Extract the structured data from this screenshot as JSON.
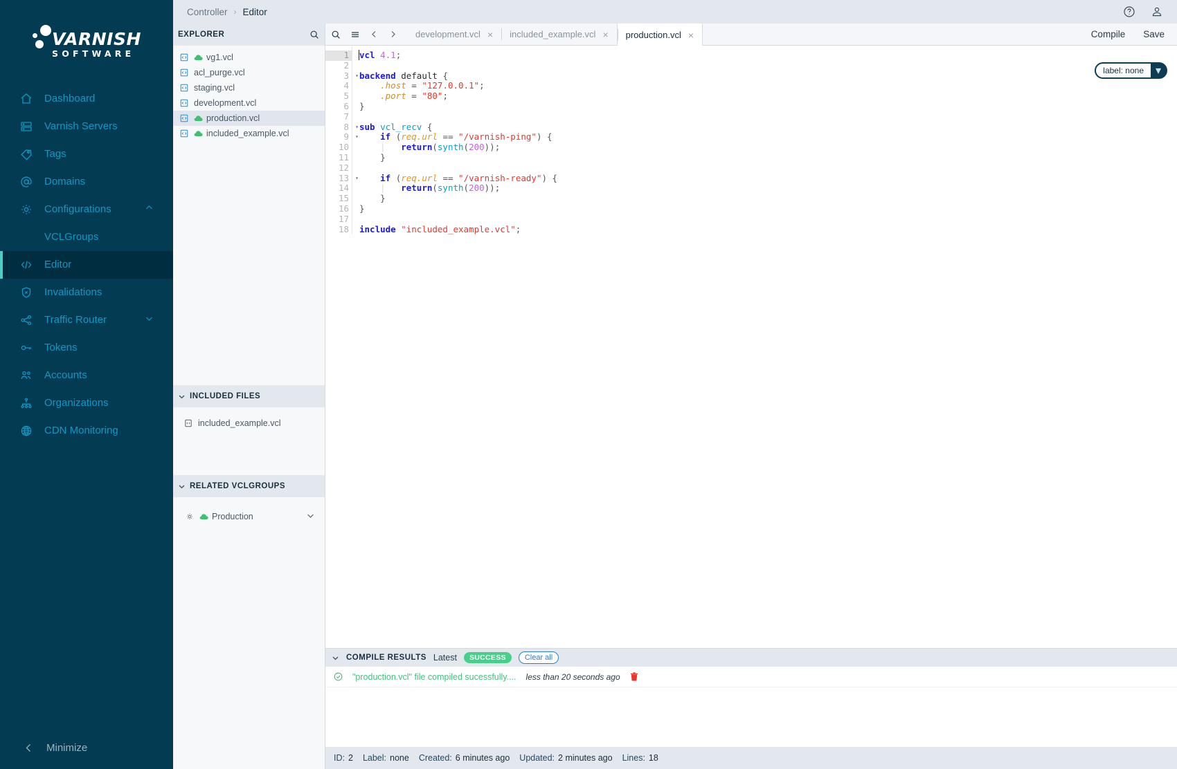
{
  "sidebar": {
    "logo": {
      "top": "VARNISH",
      "bottom": "SOFTWARE"
    },
    "items": [
      {
        "label": "Dashboard",
        "icon": "home-icon",
        "active": false,
        "chevron": ""
      },
      {
        "label": "Varnish Servers",
        "icon": "server-icon",
        "active": false,
        "chevron": ""
      },
      {
        "label": "Tags",
        "icon": "tag-icon",
        "active": false,
        "chevron": ""
      },
      {
        "label": "Domains",
        "icon": "at-icon",
        "active": false,
        "chevron": ""
      },
      {
        "label": "Configurations",
        "icon": "gear-icon",
        "active": false,
        "chevron": "chevron-up-icon"
      },
      {
        "label": "VCLGroups",
        "icon": "",
        "active": false,
        "chevron": "",
        "sub": true
      },
      {
        "label": "Editor",
        "icon": "code-icon",
        "active": true,
        "chevron": ""
      },
      {
        "label": "Invalidations",
        "icon": "shield-x-icon",
        "active": false,
        "chevron": ""
      },
      {
        "label": "Traffic Router",
        "icon": "share-icon",
        "active": false,
        "chevron": "chevron-down-icon"
      },
      {
        "label": "Tokens",
        "icon": "key-icon",
        "active": false,
        "chevron": ""
      },
      {
        "label": "Accounts",
        "icon": "users-icon",
        "active": false,
        "chevron": ""
      },
      {
        "label": "Organizations",
        "icon": "sitemap-icon",
        "active": false,
        "chevron": ""
      },
      {
        "label": "CDN Monitoring",
        "icon": "globe-icon",
        "active": false,
        "chevron": ""
      }
    ],
    "minimize_label": "Minimize"
  },
  "topbar": {
    "breadcrumb_root": "Controller",
    "breadcrumb_sep": "›",
    "breadcrumb_current": "Editor",
    "help_icon": "help-circle-icon",
    "user_icon": "user-icon"
  },
  "explorer": {
    "title": "EXPLORER",
    "search_icon": "search-icon",
    "files": [
      {
        "name": "vg1.vcl",
        "cloud": true,
        "selected": false
      },
      {
        "name": "acl_purge.vcl",
        "cloud": false,
        "selected": false
      },
      {
        "name": "staging.vcl",
        "cloud": false,
        "selected": false
      },
      {
        "name": "development.vcl",
        "cloud": false,
        "selected": false
      },
      {
        "name": "production.vcl",
        "cloud": true,
        "selected": true
      },
      {
        "name": "included_example.vcl",
        "cloud": true,
        "selected": false
      }
    ]
  },
  "included_files": {
    "title": "INCLUDED FILES",
    "items": [
      {
        "name": "included_example.vcl"
      }
    ]
  },
  "related_vclgroups": {
    "title": "RELATED VCLGROUPS",
    "items": [
      {
        "name": "Production"
      }
    ]
  },
  "editor": {
    "toolbar_icons": [
      "search-icon",
      "menu-icon",
      "chevron-left-icon",
      "chevron-right-icon"
    ],
    "tabs": [
      {
        "label": "development.vcl",
        "active": false,
        "close": "×"
      },
      {
        "label": "included_example.vcl",
        "active": false,
        "close": "×"
      },
      {
        "label": "production.vcl",
        "active": true,
        "close": "×"
      }
    ],
    "actions": [
      {
        "label": "Compile"
      },
      {
        "label": "Save"
      }
    ],
    "label_pill": {
      "text": "label: none",
      "caret": "▾"
    },
    "line_numbers": [
      "1",
      "2",
      "3",
      "4",
      "5",
      "6",
      "7",
      "8",
      "9",
      "10",
      "11",
      "12",
      "13",
      "14",
      "15",
      "16",
      "17",
      "18"
    ],
    "fold_lines": [
      3,
      8,
      9,
      13
    ],
    "current_line": 1,
    "code_lines": [
      "vcl 4.1;",
      "",
      "backend default {",
      "    .host = \"127.0.0.1\";",
      "    .port = \"80\";",
      "}",
      "",
      "sub vcl_recv {",
      "    if (req.url == \"/varnish-ping\") {",
      "        return(synth(200));",
      "    }",
      "",
      "    if (req.url == \"/varnish-ready\") {",
      "        return(synth(200));",
      "    }",
      "}",
      "",
      "include \"included_example.vcl\";"
    ]
  },
  "compile_results": {
    "title": "COMPILE RESULTS",
    "latest_label": "Latest",
    "status_badge": "SUCCESS",
    "clear_all_label": "Clear all",
    "rows": [
      {
        "status_icon": "check-circle-icon",
        "message": "\"production.vcl\" file compiled sucessfully....",
        "time": "less than 20 seconds ago",
        "delete_icon": "trash-icon"
      }
    ]
  },
  "statusbar": {
    "items": [
      {
        "key": "ID:",
        "value": "2"
      },
      {
        "key": "Label:",
        "value": "none"
      },
      {
        "key": "Created:",
        "value": "6 minutes ago"
      },
      {
        "key": "Updated:",
        "value": "2 minutes ago"
      },
      {
        "key": "Lines:",
        "value": "18"
      }
    ]
  },
  "colors": {
    "sidebar_bg": "#033b52",
    "sidebar_text": "#1397c4",
    "active_bar": "#4ecdc4",
    "success": "#46d08a",
    "cloud_green": "#3fbf6f",
    "header_bg": "#e3e8ef"
  }
}
